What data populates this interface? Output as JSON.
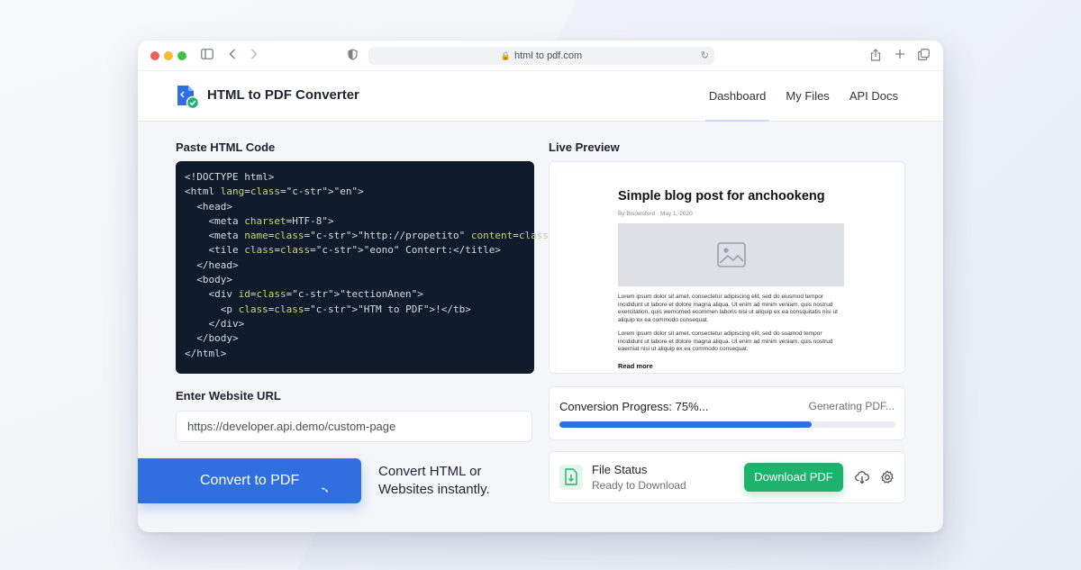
{
  "browser": {
    "address": "html to pdf.com"
  },
  "app": {
    "title": "HTML to PDF Converter",
    "nav": [
      {
        "label": "Dashboard",
        "active": true
      },
      {
        "label": "My Files",
        "active": false
      },
      {
        "label": "API Docs",
        "active": false
      }
    ]
  },
  "editor": {
    "label": "Paste HTML Code",
    "lines": [
      "<!DOCTYPE html>",
      "<html lang=\"en\">",
      "  <head>",
      "    <meta charset=HTF-8\">",
      "    <meta name=\"http://propetito\" content=\"enɪ\">",
      "    <tile class=\"eono\" Contert:</title>",
      "  </head>",
      "  <body>",
      "    <div id=\"tectionAnen\">",
      "      <p class=\"HTM to PDF\">!</tb>",
      "    </div>",
      "  </body>",
      "</html>"
    ]
  },
  "url_field": {
    "label": "Enter Website URL",
    "value": "https://developer.api.demo/custom-page"
  },
  "convert": {
    "button_label": "Convert to PDF",
    "tagline": "Convert HTML or Websites instantly."
  },
  "preview": {
    "label": "Live Preview",
    "blog_title": "Simple blog post for anchookeng",
    "meta": "By Bisowsford · May 1, 2020",
    "paragraph_1": "Lorem ipsum dolor sit amet, consectetur adipiscing elit, sed do eiusmod tempor incididunt ut labore et dolore magna aliqua. Ut enim ad minim veniam, quis nostrud exercitation, quis wemomed ecommen laboris nisi ut aliquip ex ea consquitatis nisi ut aliquip ex ea commodo consequat.",
    "paragraph_2": "Lorem ipsum dolor sit amet, consectetur adipiscing elit, sed do suamod tempor incididunt ut labore et dolore magna aliqua. Ut enim ad minim veniam, quis nostrud eaerniat nisi ut aliquip ex ea commodo consequat.",
    "read_more": "Read more"
  },
  "progress": {
    "label": "Conversion Progress: 75%...",
    "status": "Generating PDF...",
    "percent": 75
  },
  "file_status": {
    "title": "File Status",
    "subtitle": "Ready to Download",
    "download_label": "Download PDF"
  },
  "colors": {
    "accent": "#2f6fe0",
    "success": "#1fb26c",
    "editor_bg": "#0f1b2b"
  },
  "icons": [
    "sidebar-icon",
    "back-icon",
    "forward-icon",
    "shield-icon",
    "lock-icon",
    "reload-icon",
    "share-icon",
    "plus-icon",
    "tabs-icon",
    "logo-icon",
    "spinner-icon",
    "image-icon",
    "file-download-icon",
    "cloud-download-icon",
    "gear-icon"
  ]
}
